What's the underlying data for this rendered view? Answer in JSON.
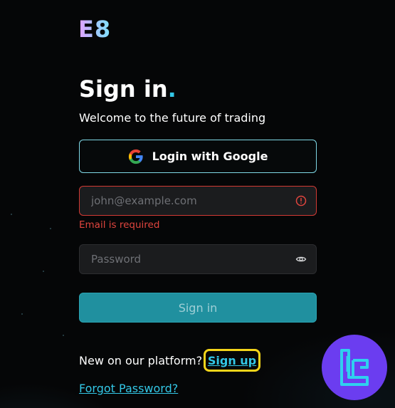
{
  "brand": {
    "logo_text": "E8"
  },
  "heading": {
    "title": "Sign in",
    "title_accent": ".",
    "subtitle": "Welcome to the future of trading"
  },
  "google_button": {
    "label": "Login with Google"
  },
  "email_field": {
    "placeholder": "john@example.com",
    "value": "",
    "error": "Email is required"
  },
  "password_field": {
    "placeholder": "Password",
    "value": ""
  },
  "submit_button": {
    "label": "Sign in"
  },
  "footer": {
    "new_prompt": "New on our platform?",
    "signup_label": "Sign up",
    "forgot_label": "Forgot Password?"
  },
  "icons": {
    "google": "google-icon",
    "error": "error-circle-icon",
    "visibility": "eye-icon",
    "watermark": "tl-logo-icon"
  },
  "colors": {
    "accent": "#33c7e6",
    "error": "#e0453e",
    "primary_button": "#20909f",
    "highlight": "#f4d51a",
    "badge": "#6b3df0"
  }
}
